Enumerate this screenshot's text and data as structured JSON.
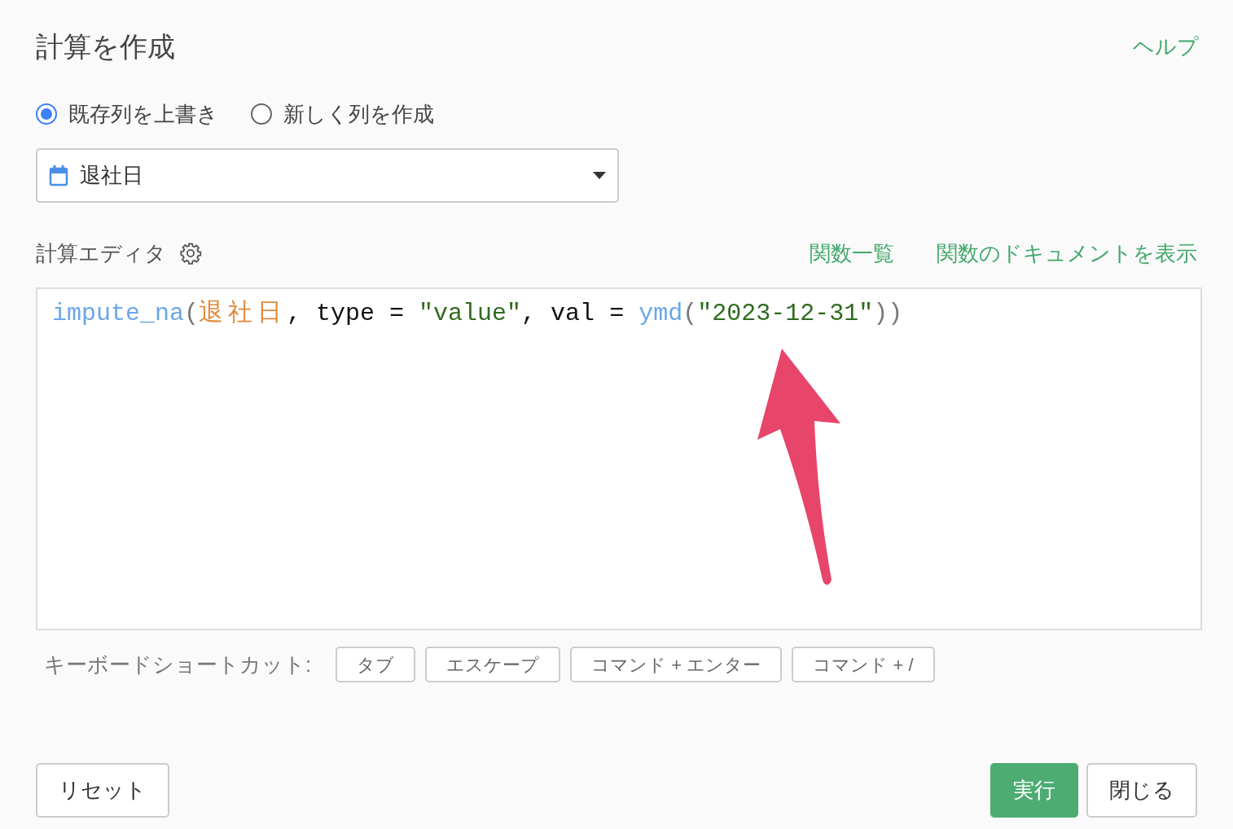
{
  "title": "計算を作成",
  "help_link": "ヘルプ",
  "modes": [
    {
      "label": "既存列を上書き",
      "selected": true
    },
    {
      "label": "新しく列を作成",
      "selected": false
    }
  ],
  "column_select": {
    "value": "退社日"
  },
  "editor": {
    "label": "計算エディタ",
    "links": [
      "関数一覧",
      "関数のドキュメントを表示"
    ],
    "tokens": [
      {
        "kind": "function",
        "text": "impute_na"
      },
      {
        "kind": "paren",
        "text": "("
      },
      {
        "kind": "column",
        "text": "退社日"
      },
      {
        "kind": "plain",
        "text": ", type = "
      },
      {
        "kind": "string",
        "text": "\"value\""
      },
      {
        "kind": "plain",
        "text": ", val = "
      },
      {
        "kind": "function",
        "text": "ymd"
      },
      {
        "kind": "paren",
        "text": "("
      },
      {
        "kind": "string",
        "text": "\"2023-12-31\""
      },
      {
        "kind": "paren",
        "text": "))"
      }
    ]
  },
  "shortcuts": {
    "label": "キーボードショートカット:",
    "keys": [
      "タブ",
      "エスケープ",
      "コマンド + エンター",
      "コマンド + /"
    ]
  },
  "buttons": {
    "reset": "リセット",
    "run": "実行",
    "close": "閉じる"
  }
}
